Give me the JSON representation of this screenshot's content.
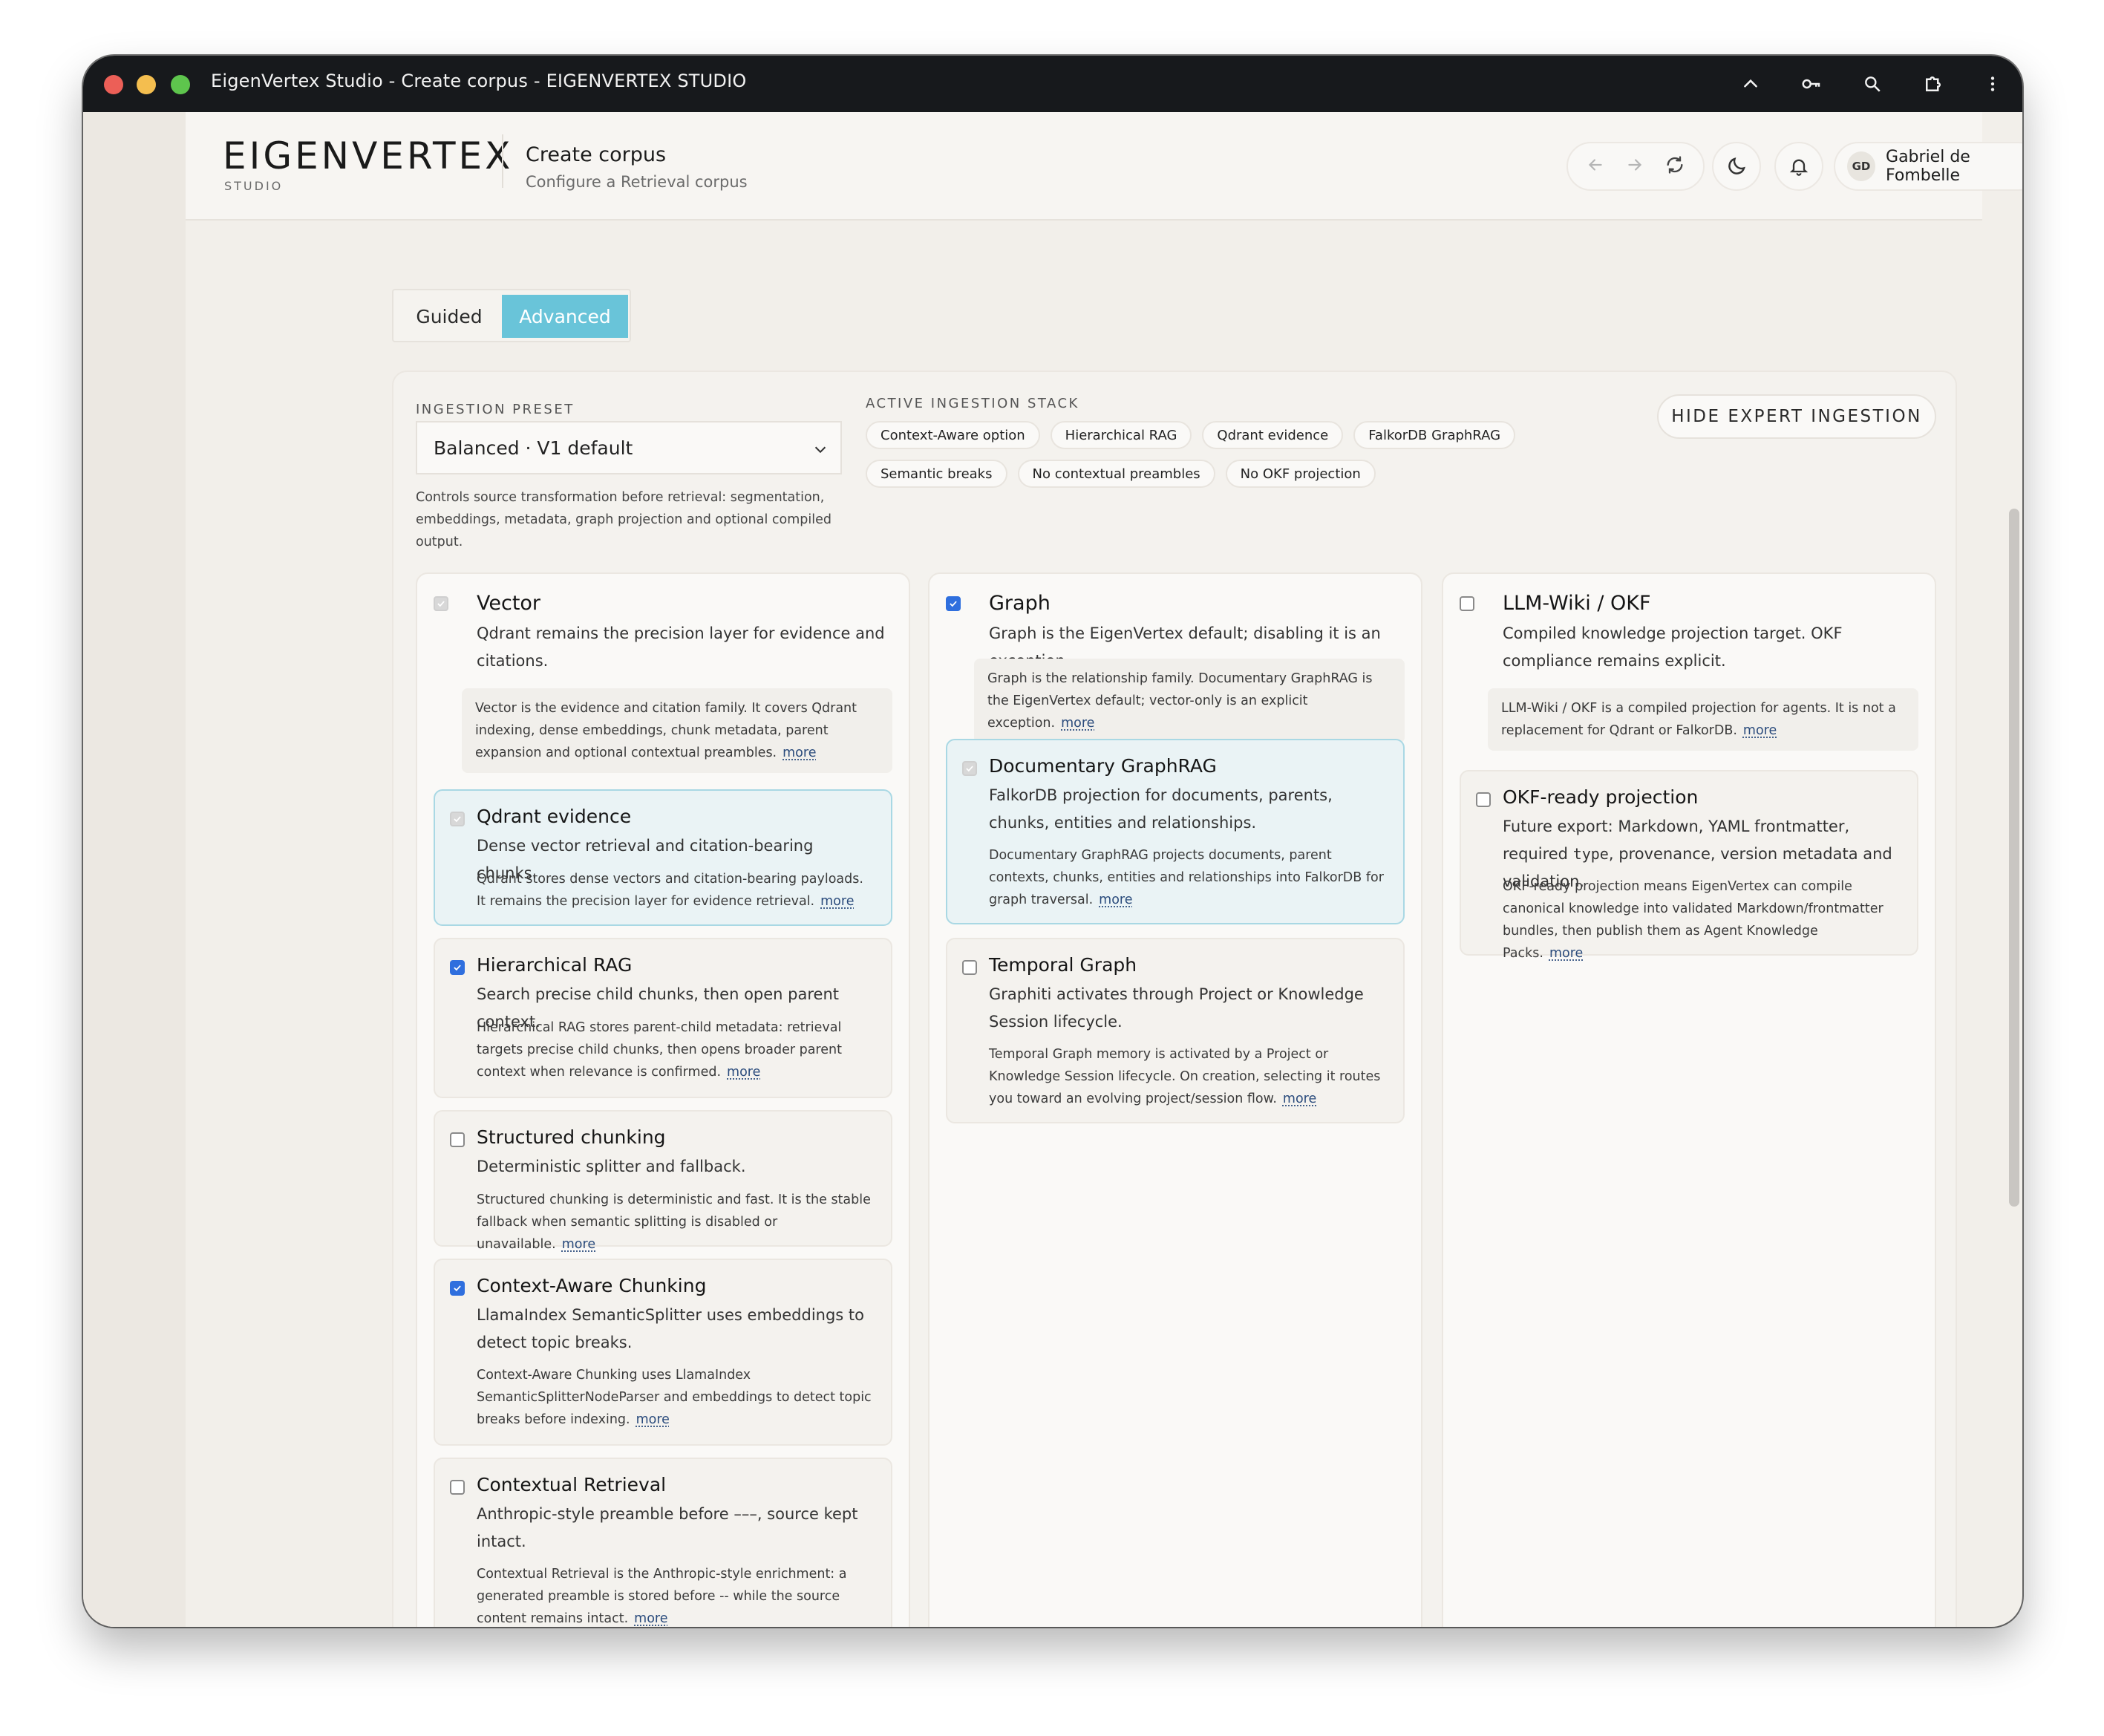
{
  "window": {
    "title": "EigenVertex Studio - Create corpus - EIGENVERTEX STUDIO"
  },
  "header": {
    "brand": "EIGENVERTEX",
    "brand_sub": "STUDIO",
    "page_title": "Create corpus",
    "page_subtitle": "Configure a Retrieval corpus",
    "user": {
      "initials": "GD",
      "name": "Gabriel de Fombelle"
    }
  },
  "mode": {
    "guided": "Guided",
    "advanced": "Advanced",
    "selected": "Advanced"
  },
  "ingestion": {
    "preset_label": "INGESTION PRESET",
    "preset_value": "Balanced · V1 default",
    "preset_help": "Controls source transformation before retrieval: segmentation, embeddings, metadata, graph projection and optional compiled output.",
    "stack_label": "ACTIVE INGESTION STACK",
    "stack_chips": [
      "Context-Aware option",
      "Hierarchical RAG",
      "Qdrant evidence",
      "FalkorDB GraphRAG",
      "Semantic breaks",
      "No contextual preambles",
      "No OKF projection"
    ],
    "hide_button": "HIDE EXPERT INGESTION"
  },
  "more_label": "more",
  "columns": {
    "vector": {
      "title": "Vector",
      "subtitle": "Qdrant remains the precision layer for evidence and citations.",
      "note": "Vector is the evidence and citation family. It covers Qdrant indexing, dense embeddings, chunk metadata, parent expansion and optional contextual preambles.",
      "cards": [
        {
          "title": "Qdrant evidence",
          "subtitle": "Dense vector retrieval and citation-bearing chunks.",
          "body": "Qdrant stores dense vectors and citation-bearing payloads. It remains the precision layer for evidence retrieval.",
          "state": "locked"
        },
        {
          "title": "Hierarchical RAG",
          "subtitle": "Search precise child chunks, then open parent context.",
          "body": "Hierarchical RAG stores parent-child metadata: retrieval targets precise child chunks, then opens broader parent context when relevance is confirmed.",
          "state": "checked"
        },
        {
          "title": "Structured chunking",
          "subtitle": "Deterministic splitter and fallback.",
          "body": "Structured chunking is deterministic and fast. It is the stable fallback when semantic splitting is disabled or unavailable.",
          "state": "unchecked"
        },
        {
          "title": "Context-Aware Chunking",
          "subtitle": "LlamaIndex SemanticSplitter uses embeddings to detect topic breaks.",
          "body": "Context-Aware Chunking uses LlamaIndex SemanticSplitterNodeParser and embeddings to detect topic breaks before indexing.",
          "state": "checked"
        },
        {
          "title": "Contextual Retrieval",
          "subtitle": "Anthropic-style preamble before –––, source kept intact.",
          "body": "Contextual Retrieval is the Anthropic-style enrichment: a generated preamble is stored before -- while the source content remains intact.",
          "state": "unchecked"
        }
      ]
    },
    "graph": {
      "title": "Graph",
      "subtitle": "Graph is the EigenVertex default; disabling it is an exception.",
      "note": "Graph is the relationship family. Documentary GraphRAG is the EigenVertex default; vector-only is an explicit exception.",
      "cards": [
        {
          "title": "Documentary GraphRAG",
          "subtitle": "FalkorDB projection for documents, parents, chunks, entities and relationships.",
          "body": "Documentary GraphRAG projects documents, parent contexts, chunks, entities and relationships into FalkorDB for graph traversal.",
          "state": "locked"
        },
        {
          "title": "Temporal Graph",
          "subtitle": "Graphiti activates through Project or Knowledge Session lifecycle.",
          "body": "Temporal Graph memory is activated by a Project or Knowledge Session lifecycle. On creation, selecting it routes you toward an evolving project/session flow.",
          "state": "unchecked"
        }
      ]
    },
    "okf": {
      "title": "LLM-Wiki / OKF",
      "subtitle": "Compiled knowledge projection target. OKF compliance remains explicit.",
      "note": "LLM-Wiki / OKF is a compiled projection for agents. It is not a replacement for Qdrant or FalkorDB.",
      "cards": [
        {
          "title": "OKF-ready projection",
          "subtitle_a": "Future export: Markdown, YAML frontmatter, required",
          "subtitle_code": "type",
          "subtitle_b": ", provenance, version metadata and validation.",
          "body": "OKF-ready projection means EigenVertex can compile canonical knowledge into validated Markdown/frontmatter bundles, then publish them as Agent Knowledge Packs.",
          "state": "unchecked"
        }
      ]
    }
  },
  "colors": {
    "accent": "#69c4d9",
    "checkbox_blue": "#2f6fde",
    "highlight_card": "#eaf3f5"
  }
}
